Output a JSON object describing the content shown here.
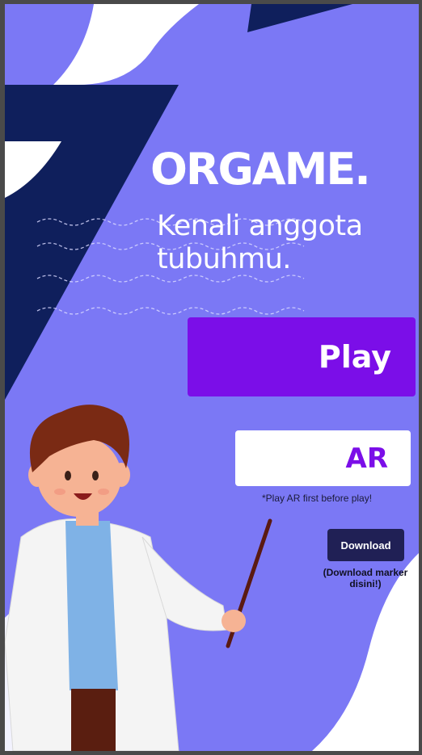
{
  "app": {
    "title": "ORGAME.",
    "tagline": "Kenali anggota tubuhmu."
  },
  "buttons": {
    "play_label": "Play",
    "ar_label": "AR",
    "download_label": "Download"
  },
  "notes": {
    "ar_note": "*Play AR first before play!",
    "download_note": "(Download marker disini!)"
  },
  "colors": {
    "background": "#7b78f5",
    "navy_shape": "#0f1f5c",
    "play_button": "#7b0ee8",
    "download_button": "#202055"
  },
  "illustration": {
    "character": "scientist-with-pointer"
  }
}
